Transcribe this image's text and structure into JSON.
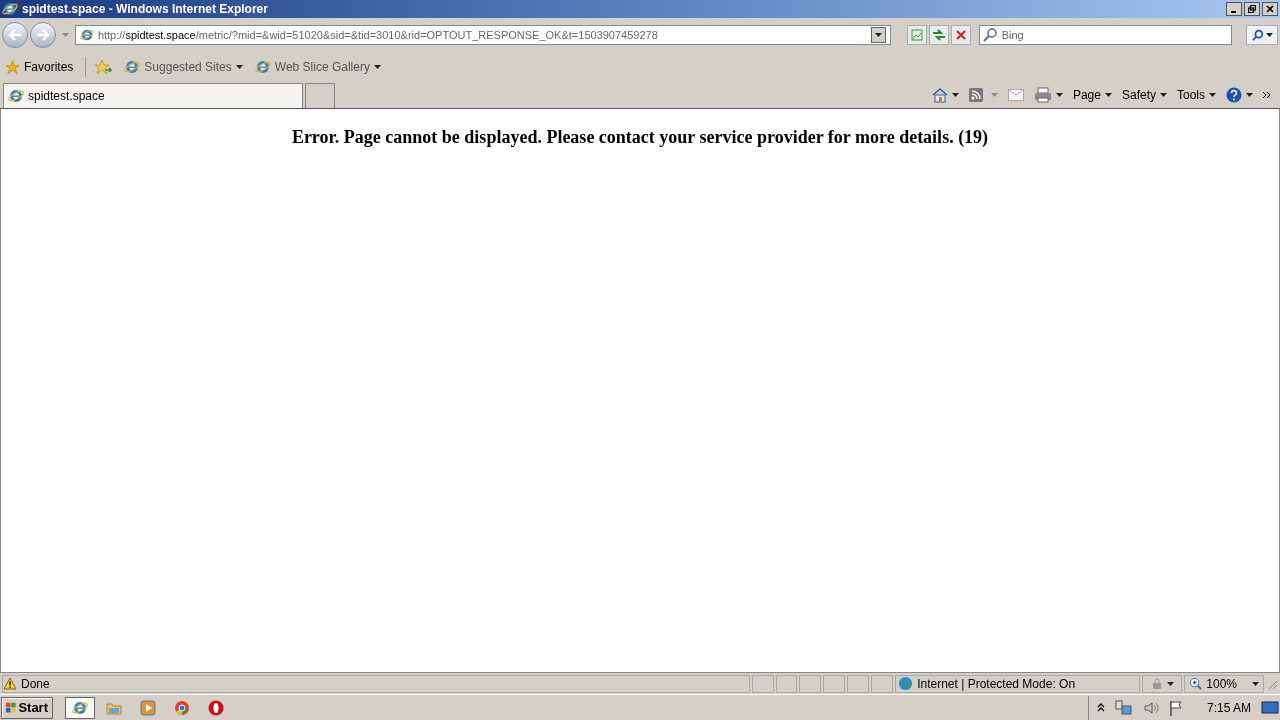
{
  "window": {
    "title": "spidtest.space - Windows Internet Explorer"
  },
  "address": {
    "scheme": "http://",
    "host": "spidtest.space",
    "path": "/metric/?mid=&wid=51020&sid=&tid=3010&rid=OPTOUT_RESPONSE_OK&t=1503907459278"
  },
  "search": {
    "placeholder": "Bing"
  },
  "favorites_bar": {
    "favorites": "Favorites",
    "links": [
      "Suggested Sites",
      "Web Slice Gallery"
    ]
  },
  "tabs": [
    {
      "label": "spidtest.space",
      "selected": true
    }
  ],
  "command_bar": [
    "Page",
    "Safety",
    "Tools"
  ],
  "content": {
    "message": "Error. Page cannot be displayed. Please contact your service provider for more details. (19)"
  },
  "status_bar": {
    "status": "Done",
    "zone": "Internet | Protected Mode: On",
    "zoom": "100%"
  },
  "taskbar": {
    "start": "Start",
    "clock": "7:15 AM"
  }
}
